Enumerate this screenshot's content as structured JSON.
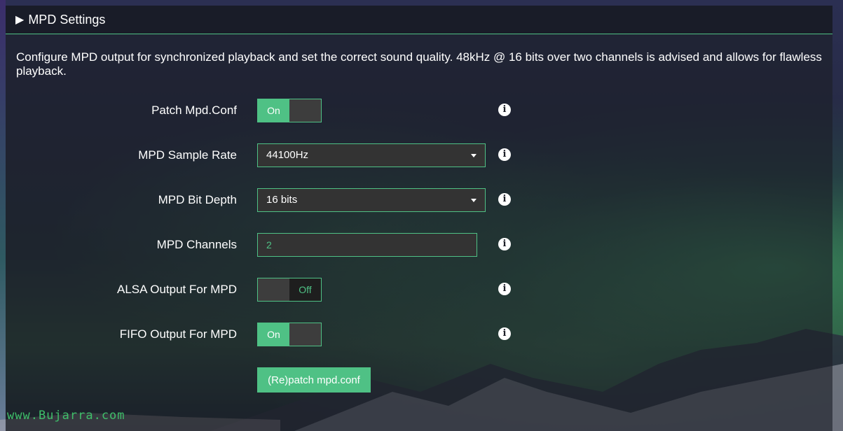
{
  "header": {
    "arrow": "▶",
    "title": "MPD Settings"
  },
  "description": "Configure MPD output for synchronized playback and set the correct sound quality. 48kHz @ 16 bits over two channels is advised and allows for flawless playback.",
  "settings": {
    "patch_mpd_conf": {
      "label": "Patch Mpd.Conf",
      "state": "On"
    },
    "sample_rate": {
      "label": "MPD Sample Rate",
      "value": "44100Hz"
    },
    "bit_depth": {
      "label": "MPD Bit Depth",
      "value": "16 bits"
    },
    "channels": {
      "label": "MPD Channels",
      "value": "2"
    },
    "alsa_output": {
      "label": "ALSA Output For MPD",
      "state": "Off"
    },
    "fifo_output": {
      "label": "FIFO Output For MPD",
      "state": "On"
    }
  },
  "info_icon": "i",
  "patch_button": "(Re)patch mpd.conf",
  "watermark": "www.Bujarra.com",
  "colors": {
    "accent": "#4fc185",
    "panel": "#1c1e26",
    "field": "#333333"
  }
}
